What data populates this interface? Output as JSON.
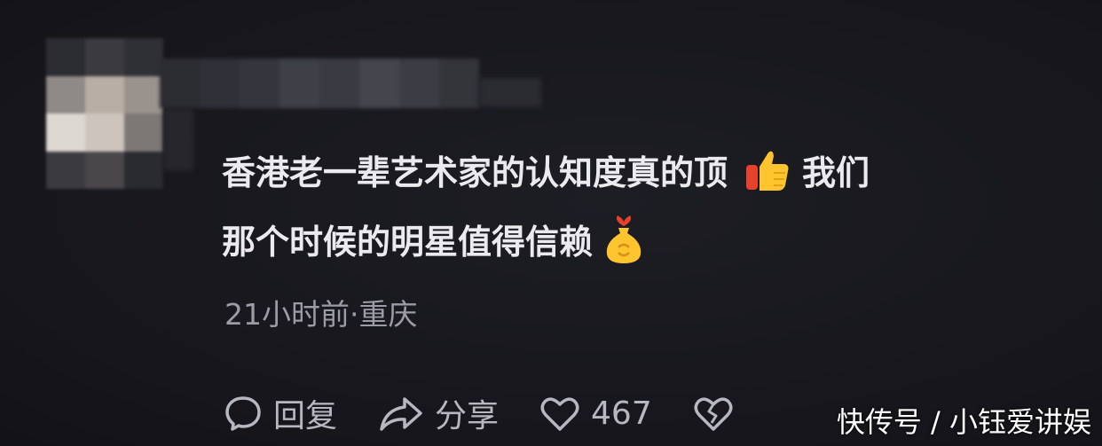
{
  "comment": {
    "line1": "香港老一辈艺术家的认知度真的顶",
    "line1_after_emoji": "我们",
    "line2": "那个时候的明星值得信赖",
    "emoji_1": "thumbs-up",
    "emoji_2": "money-bag"
  },
  "meta": {
    "time_location": "21小时前·重庆"
  },
  "actions": {
    "reply_label": "回复",
    "share_label": "分享",
    "like_count": "467"
  },
  "watermark": "快传号 / 小钰爱讲娱",
  "colors": {
    "background": "#17171d",
    "text": "#ebebef",
    "meta": "#9c9ca6",
    "thumb_red": "#e8412b",
    "thumb_yellow": "#ffc42e"
  }
}
